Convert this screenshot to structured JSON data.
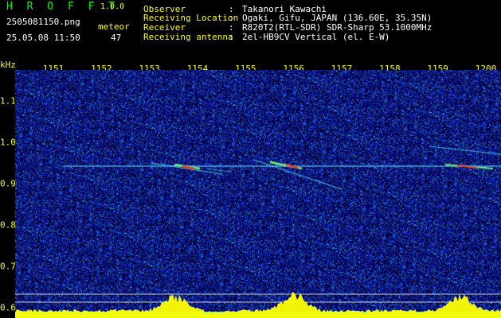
{
  "brand": {
    "name": "H R O F F T",
    "version": "1.0.0"
  },
  "file": {
    "name": "2505081150.png",
    "datetime": "25.05.08 11:50"
  },
  "detection": {
    "label": "meteor",
    "count": "47"
  },
  "header": [
    {
      "label": "Observer",
      "value": "Takanori Kawachi"
    },
    {
      "label": "Receiving Location",
      "value": "Ogaki, Gifu, JAPAN (136.60E, 35.35N)"
    },
    {
      "label": "Receiver",
      "value": "R820T2(RTL-SDR) SDR-Sharp 53.1000MHz"
    },
    {
      "label": "Receiving antenna",
      "value": "2el-HB9CV Vertical (el. E-W)"
    }
  ],
  "axis": {
    "y_unit": "kHz",
    "x_ticks": [
      "1151",
      "1152",
      "1153",
      "1154",
      "1155",
      "1156",
      "1157",
      "1158",
      "1159",
      "1200"
    ],
    "y_ticks": [
      "1.1",
      "1.0",
      "0.9",
      "0.8",
      "0.7",
      "0.6"
    ],
    "y_values": [
      1.1,
      1.0,
      0.9,
      0.8,
      0.7,
      0.6
    ],
    "y_range": [
      0.575,
      1.175
    ]
  },
  "colors": {
    "label_yellow": "#ffff00",
    "text_white": "#ffffff",
    "brand_green": "#00ff00",
    "noise_blue": "#1020a0",
    "signal_cyan": "#40d0ff",
    "spectrum_fill": "#ffff00",
    "spectrum_base": "#00c0ff"
  }
}
